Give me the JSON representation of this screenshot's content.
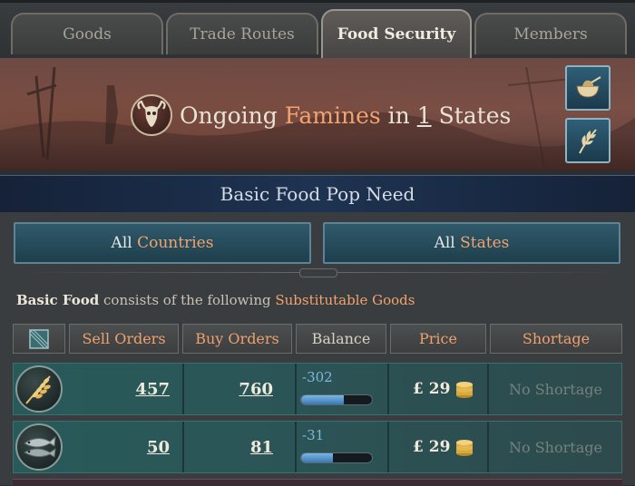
{
  "tabs": [
    {
      "label": "Goods"
    },
    {
      "label": "Trade Routes"
    },
    {
      "label": "Food Security"
    },
    {
      "label": "Members"
    }
  ],
  "banner": {
    "prefix": "Ongoing",
    "highlight": "Famines",
    "mid": "in",
    "count": "1",
    "suffix": "States",
    "emblem_icon": "famine-skull-icon",
    "side_buttons": [
      {
        "icon": "food-bowl-icon"
      },
      {
        "icon": "grain-leaf-icon"
      }
    ]
  },
  "section": {
    "title": "Basic Food Pop Need"
  },
  "scope": {
    "countries": {
      "prefix": "All",
      "highlight": "Countries"
    },
    "states": {
      "prefix": "All",
      "highlight": "States"
    }
  },
  "description": {
    "bold": "Basic Food",
    "mid": "consists of the following",
    "highlight": "Substitutable Goods"
  },
  "table": {
    "headers": {
      "sell_orders": "Sell Orders",
      "buy_orders": "Buy Orders",
      "balance": "Balance",
      "price": "Price",
      "shortage": "Shortage"
    },
    "rows": [
      {
        "good_icon": "grain-icon",
        "sell_orders": "457",
        "buy_orders": "760",
        "balance": "-302",
        "balance_fill_pct": 60,
        "price": "£ 29",
        "shortage": "No Shortage"
      },
      {
        "good_icon": "fish-icon",
        "sell_orders": "50",
        "buy_orders": "81",
        "balance": "-31",
        "balance_fill_pct": 45,
        "price": "£ 29",
        "shortage": "No Shortage"
      }
    ]
  },
  "colors": {
    "accent_orange": "#f3a36f",
    "balance_blue": "#7fb7e0",
    "row_teal": "#2b5557"
  }
}
